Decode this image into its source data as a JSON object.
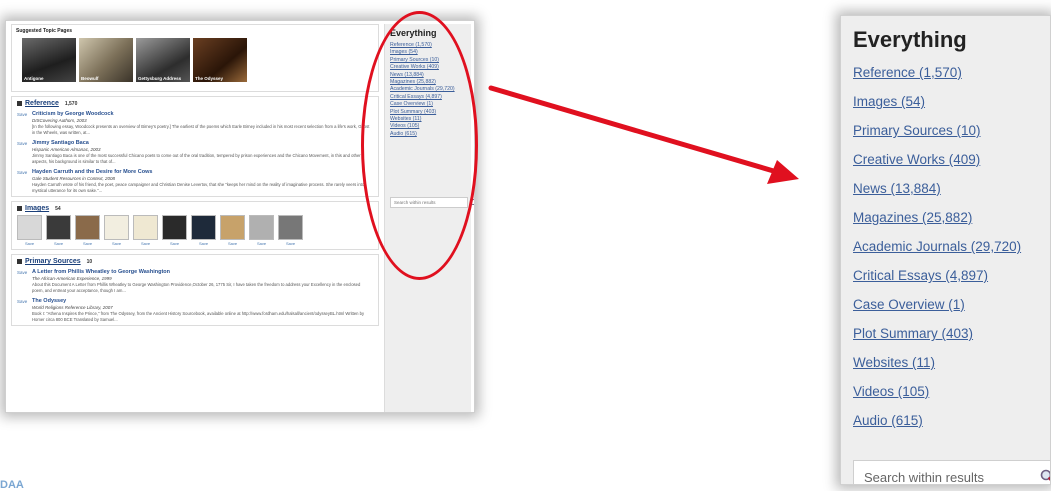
{
  "shot": {
    "suggested_topics": {
      "heading": "Suggested Topic Pages",
      "topics": [
        "Antigone",
        "Beowulf",
        "Gettysburg Address",
        "The Odyssey"
      ]
    },
    "reference": {
      "name": "Reference",
      "count": "1,570",
      "entries": [
        {
          "save": "Save",
          "title": "Criticism by George Woodcock",
          "source": "DISCovering Authors, 2003",
          "snippet": "[In the following essay, Woodcock presents an overview of Birney's poetry.] The earliest of the poems which Earle Birney included in his most recent selection from a life's work, Ghost in the Wheels, was written, at..."
        },
        {
          "save": "Save",
          "title": "Jimmy Santiago Baca",
          "source": "Hispanic American Almanac, 2003",
          "snippet": "Jimmy Santiago Baca is one of the most successful Chicano poets to come out of the oral tradition, tempered by prison experiences and the Chicano Movement, in this and other aspects, his background is similar to that of..."
        },
        {
          "save": "Save",
          "title": "Hayden Carruth and the Desire for More Cows",
          "source": "Gale Student Resources in Context, 2008",
          "snippet": "Hayden Carruth wrote of his friend, the poet, peace campaigner and Christian Denise Levertov, that she \"keeps her mind on the reality of imaginative process. She rarely veers into mystical utterance for its own sake.\"..."
        }
      ]
    },
    "images": {
      "name": "Images",
      "count": "54",
      "save_labels": [
        "Save",
        "Save",
        "Save",
        "Save",
        "Save",
        "Save",
        "Save",
        "Save",
        "Save",
        "Save"
      ]
    },
    "primary_sources": {
      "name": "Primary Sources",
      "count": "10",
      "entries": [
        {
          "save": "Save",
          "title": "A Letter from Phillis Wheatley to George Washington",
          "source": "The African-American Experience, 1999",
          "snippet": "About this Document A Letter from Phillis Wheatley to George Washington Providence,October 26, 1775 Sir, I have taken the freedom to address your Excellency in the enclosed poem, and entreat your acceptance, though I am..."
        },
        {
          "save": "Save",
          "title": "The Odyssey",
          "source": "World Religions Reference Library, 2007",
          "snippet": "Book I: \"Athena Inspires the Prince,\" from The Odyssey, from the Ancient History Sourcebook, available online at http://www.fordham.edu/halsall/ancient/odysseyBL.html Written by Homer circa 800 BCE Translated by Samuel..."
        }
      ]
    },
    "sidebar": {
      "heading": "Everything",
      "links": [
        "Reference (1,570)",
        "Images (54)",
        "Primary Sources (10)",
        "Creative Works (409)",
        "News (13,884)",
        "Magazines (25,882)",
        "Academic Journals (29,720)",
        "Critical Essays (4,897)",
        "Case Overview (1)",
        "Plot Summary (403)",
        "Websites (11)",
        "Videos (105)",
        "Audio (615)"
      ],
      "search_placeholder": "Search within results"
    }
  },
  "zoom": {
    "heading": "Everything",
    "links": [
      "Reference (1,570)",
      "Images (54)",
      "Primary Sources (10)",
      "Creative Works (409)",
      "News (13,884)",
      "Magazines (25,882)",
      "Academic Journals (29,720)",
      "Critical Essays (4,897)",
      "Case Overview (1)",
      "Plot Summary (403)",
      "Websites (11)",
      "Videos (105)",
      "Audio (615)"
    ],
    "search_placeholder": "Search within results"
  },
  "colors": {
    "highlight": "#e0101f",
    "link": "#3b5e9a",
    "panel_bg": "#eeeeee"
  },
  "fragment_text": "DAA"
}
